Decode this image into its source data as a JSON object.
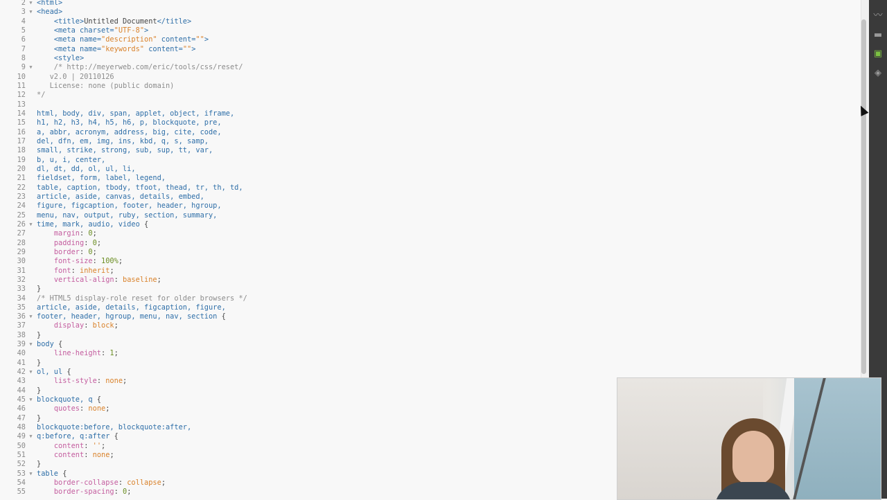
{
  "editor": {
    "lines": [
      {
        "n": "2",
        "fold": true,
        "t": [
          [
            "tag",
            "<html>"
          ]
        ]
      },
      {
        "n": "3",
        "fold": true,
        "t": [
          [
            "tag",
            "<head>"
          ]
        ]
      },
      {
        "n": "4",
        "fold": false,
        "t": [
          [
            "pun",
            "    "
          ],
          [
            "tag",
            "<title>"
          ],
          [
            "pun",
            "Untitled Document"
          ],
          [
            "tag",
            "</title>"
          ]
        ]
      },
      {
        "n": "5",
        "fold": false,
        "t": [
          [
            "pun",
            "    "
          ],
          [
            "tag",
            "<meta "
          ],
          [
            "attr",
            "charset="
          ],
          [
            "str",
            "\"UTF-8\""
          ],
          [
            "tag",
            ">"
          ]
        ]
      },
      {
        "n": "6",
        "fold": false,
        "t": [
          [
            "pun",
            "    "
          ],
          [
            "tag",
            "<meta "
          ],
          [
            "attr",
            "name="
          ],
          [
            "str",
            "\"description\""
          ],
          [
            "attr",
            " content="
          ],
          [
            "str",
            "\"\""
          ],
          [
            "tag",
            ">"
          ]
        ]
      },
      {
        "n": "7",
        "fold": false,
        "t": [
          [
            "pun",
            "    "
          ],
          [
            "tag",
            "<meta "
          ],
          [
            "attr",
            "name="
          ],
          [
            "str",
            "\"keywords\""
          ],
          [
            "attr",
            " content="
          ],
          [
            "str",
            "\"\""
          ],
          [
            "tag",
            ">"
          ]
        ]
      },
      {
        "n": "8",
        "fold": false,
        "t": [
          [
            "pun",
            "    "
          ],
          [
            "tag",
            "<style>"
          ]
        ]
      },
      {
        "n": "9",
        "fold": true,
        "t": [
          [
            "cmt",
            "    /* http://meyerweb.com/eric/tools/css/reset/"
          ]
        ]
      },
      {
        "n": "10",
        "fold": false,
        "t": [
          [
            "cmt",
            "   v2.0 | 20110126"
          ]
        ]
      },
      {
        "n": "11",
        "fold": false,
        "t": [
          [
            "cmt",
            "   License: none (public domain)"
          ]
        ]
      },
      {
        "n": "12",
        "fold": false,
        "t": [
          [
            "cmt",
            "*/"
          ]
        ]
      },
      {
        "n": "13",
        "fold": false,
        "t": [
          [
            "pun",
            ""
          ]
        ]
      },
      {
        "n": "14",
        "fold": false,
        "t": [
          [
            "sel",
            "html, body, div, span, applet, object, iframe,"
          ]
        ]
      },
      {
        "n": "15",
        "fold": false,
        "t": [
          [
            "sel",
            "h1, h2, h3, h4, h5, h6, p, blockquote, pre,"
          ]
        ]
      },
      {
        "n": "16",
        "fold": false,
        "t": [
          [
            "sel",
            "a, abbr, acronym, address, big, cite, code,"
          ]
        ]
      },
      {
        "n": "17",
        "fold": false,
        "t": [
          [
            "sel",
            "del, dfn, em, img, ins, kbd, q, s, samp,"
          ]
        ]
      },
      {
        "n": "18",
        "fold": false,
        "t": [
          [
            "sel",
            "small, strike, strong, sub, sup, tt, var,"
          ]
        ]
      },
      {
        "n": "19",
        "fold": false,
        "t": [
          [
            "sel",
            "b, u, i, center,"
          ]
        ]
      },
      {
        "n": "20",
        "fold": false,
        "t": [
          [
            "sel",
            "dl, dt, dd, ol, ul, li,"
          ]
        ]
      },
      {
        "n": "21",
        "fold": false,
        "t": [
          [
            "sel",
            "fieldset, form, label, legend,"
          ]
        ]
      },
      {
        "n": "22",
        "fold": false,
        "t": [
          [
            "sel",
            "table, caption, tbody, tfoot, thead, tr, th, td,"
          ]
        ]
      },
      {
        "n": "23",
        "fold": false,
        "t": [
          [
            "sel",
            "article, aside, canvas, details, embed,"
          ]
        ]
      },
      {
        "n": "24",
        "fold": false,
        "t": [
          [
            "sel",
            "figure, figcaption, footer, header, hgroup,"
          ]
        ]
      },
      {
        "n": "25",
        "fold": false,
        "t": [
          [
            "sel",
            "menu, nav, output, ruby, section, summary,"
          ]
        ]
      },
      {
        "n": "26",
        "fold": true,
        "t": [
          [
            "sel",
            "time, mark, audio, video "
          ],
          [
            "pun",
            "{"
          ]
        ]
      },
      {
        "n": "27",
        "fold": false,
        "t": [
          [
            "pun",
            "    "
          ],
          [
            "prop",
            "margin"
          ],
          [
            "pun",
            ": "
          ],
          [
            "num",
            "0"
          ],
          [
            "pun",
            ";"
          ]
        ]
      },
      {
        "n": "28",
        "fold": false,
        "t": [
          [
            "pun",
            "    "
          ],
          [
            "prop",
            "padding"
          ],
          [
            "pun",
            ": "
          ],
          [
            "num",
            "0"
          ],
          [
            "pun",
            ";"
          ]
        ]
      },
      {
        "n": "29",
        "fold": false,
        "t": [
          [
            "pun",
            "    "
          ],
          [
            "prop",
            "border"
          ],
          [
            "pun",
            ": "
          ],
          [
            "num",
            "0"
          ],
          [
            "pun",
            ";"
          ]
        ]
      },
      {
        "n": "30",
        "fold": false,
        "t": [
          [
            "pun",
            "    "
          ],
          [
            "prop",
            "font-size"
          ],
          [
            "pun",
            ": "
          ],
          [
            "num",
            "100%"
          ],
          [
            "pun",
            ";"
          ]
        ]
      },
      {
        "n": "31",
        "fold": false,
        "t": [
          [
            "pun",
            "    "
          ],
          [
            "prop",
            "font"
          ],
          [
            "pun",
            ": "
          ],
          [
            "val",
            "inherit"
          ],
          [
            "pun",
            ";"
          ]
        ]
      },
      {
        "n": "32",
        "fold": false,
        "t": [
          [
            "pun",
            "    "
          ],
          [
            "prop",
            "vertical-align"
          ],
          [
            "pun",
            ": "
          ],
          [
            "val",
            "baseline"
          ],
          [
            "pun",
            ";"
          ]
        ]
      },
      {
        "n": "33",
        "fold": false,
        "t": [
          [
            "pun",
            "}"
          ]
        ]
      },
      {
        "n": "34",
        "fold": false,
        "t": [
          [
            "cmt",
            "/* HTML5 display-role reset for older browsers */"
          ]
        ]
      },
      {
        "n": "35",
        "fold": false,
        "t": [
          [
            "sel",
            "article, aside, details, figcaption, figure,"
          ]
        ]
      },
      {
        "n": "36",
        "fold": true,
        "t": [
          [
            "sel",
            "footer, header, hgroup, menu, nav, section "
          ],
          [
            "pun",
            "{"
          ]
        ]
      },
      {
        "n": "37",
        "fold": false,
        "t": [
          [
            "pun",
            "    "
          ],
          [
            "prop",
            "display"
          ],
          [
            "pun",
            ": "
          ],
          [
            "val",
            "block"
          ],
          [
            "pun",
            ";"
          ]
        ]
      },
      {
        "n": "38",
        "fold": false,
        "t": [
          [
            "pun",
            "}"
          ]
        ]
      },
      {
        "n": "39",
        "fold": true,
        "t": [
          [
            "sel",
            "body "
          ],
          [
            "pun",
            "{"
          ]
        ]
      },
      {
        "n": "40",
        "fold": false,
        "t": [
          [
            "pun",
            "    "
          ],
          [
            "prop",
            "line-height"
          ],
          [
            "pun",
            ": "
          ],
          [
            "num",
            "1"
          ],
          [
            "pun",
            ";"
          ]
        ]
      },
      {
        "n": "41",
        "fold": false,
        "t": [
          [
            "pun",
            "}"
          ]
        ]
      },
      {
        "n": "42",
        "fold": true,
        "t": [
          [
            "sel",
            "ol, ul "
          ],
          [
            "pun",
            "{"
          ]
        ]
      },
      {
        "n": "43",
        "fold": false,
        "t": [
          [
            "pun",
            "    "
          ],
          [
            "prop",
            "list-style"
          ],
          [
            "pun",
            ": "
          ],
          [
            "val",
            "none"
          ],
          [
            "pun",
            ";"
          ]
        ]
      },
      {
        "n": "44",
        "fold": false,
        "t": [
          [
            "pun",
            "}"
          ]
        ]
      },
      {
        "n": "45",
        "fold": true,
        "t": [
          [
            "sel",
            "blockquote, q "
          ],
          [
            "pun",
            "{"
          ]
        ]
      },
      {
        "n": "46",
        "fold": false,
        "t": [
          [
            "pun",
            "    "
          ],
          [
            "prop",
            "quotes"
          ],
          [
            "pun",
            ": "
          ],
          [
            "val",
            "none"
          ],
          [
            "pun",
            ";"
          ]
        ]
      },
      {
        "n": "47",
        "fold": false,
        "t": [
          [
            "pun",
            "}"
          ]
        ]
      },
      {
        "n": "48",
        "fold": false,
        "t": [
          [
            "sel",
            "blockquote:before, blockquote:after,"
          ]
        ]
      },
      {
        "n": "49",
        "fold": true,
        "t": [
          [
            "sel",
            "q:before, q:after "
          ],
          [
            "pun",
            "{"
          ]
        ]
      },
      {
        "n": "50",
        "fold": false,
        "t": [
          [
            "pun",
            "    "
          ],
          [
            "prop",
            "content"
          ],
          [
            "pun",
            ": "
          ],
          [
            "str",
            "''"
          ],
          [
            "pun",
            ";"
          ]
        ]
      },
      {
        "n": "51",
        "fold": false,
        "t": [
          [
            "pun",
            "    "
          ],
          [
            "prop",
            "content"
          ],
          [
            "pun",
            ": "
          ],
          [
            "val",
            "none"
          ],
          [
            "pun",
            ";"
          ]
        ]
      },
      {
        "n": "52",
        "fold": false,
        "t": [
          [
            "pun",
            "}"
          ]
        ]
      },
      {
        "n": "53",
        "fold": true,
        "t": [
          [
            "sel",
            "table "
          ],
          [
            "pun",
            "{"
          ]
        ]
      },
      {
        "n": "54",
        "fold": false,
        "t": [
          [
            "pun",
            "    "
          ],
          [
            "prop",
            "border-collapse"
          ],
          [
            "pun",
            ": "
          ],
          [
            "val",
            "collapse"
          ],
          [
            "pun",
            ";"
          ]
        ]
      },
      {
        "n": "55",
        "fold": false,
        "t": [
          [
            "pun",
            "    "
          ],
          [
            "prop",
            "border-spacing"
          ],
          [
            "pun",
            ": "
          ],
          [
            "num",
            "0"
          ],
          [
            "pun",
            ";"
          ]
        ]
      }
    ]
  },
  "toolbar": {
    "icons": [
      "activity-icon",
      "briefcase-icon",
      "gift-icon",
      "layers-icon"
    ],
    "glyphs": [
      "〰",
      "▬",
      "▣",
      "◈"
    ],
    "colors": [
      "#9a9a9a",
      "#9a9a9a",
      "#7cc242",
      "#9a9a9a"
    ]
  },
  "colors": {
    "background": "#f8f8f8",
    "toolbar": "#3a3a3a",
    "selector": "#2f6fa8",
    "property": "#c45d9f",
    "value": "#d9822b",
    "number": "#6b8e23",
    "comment": "#8c8c8c"
  }
}
